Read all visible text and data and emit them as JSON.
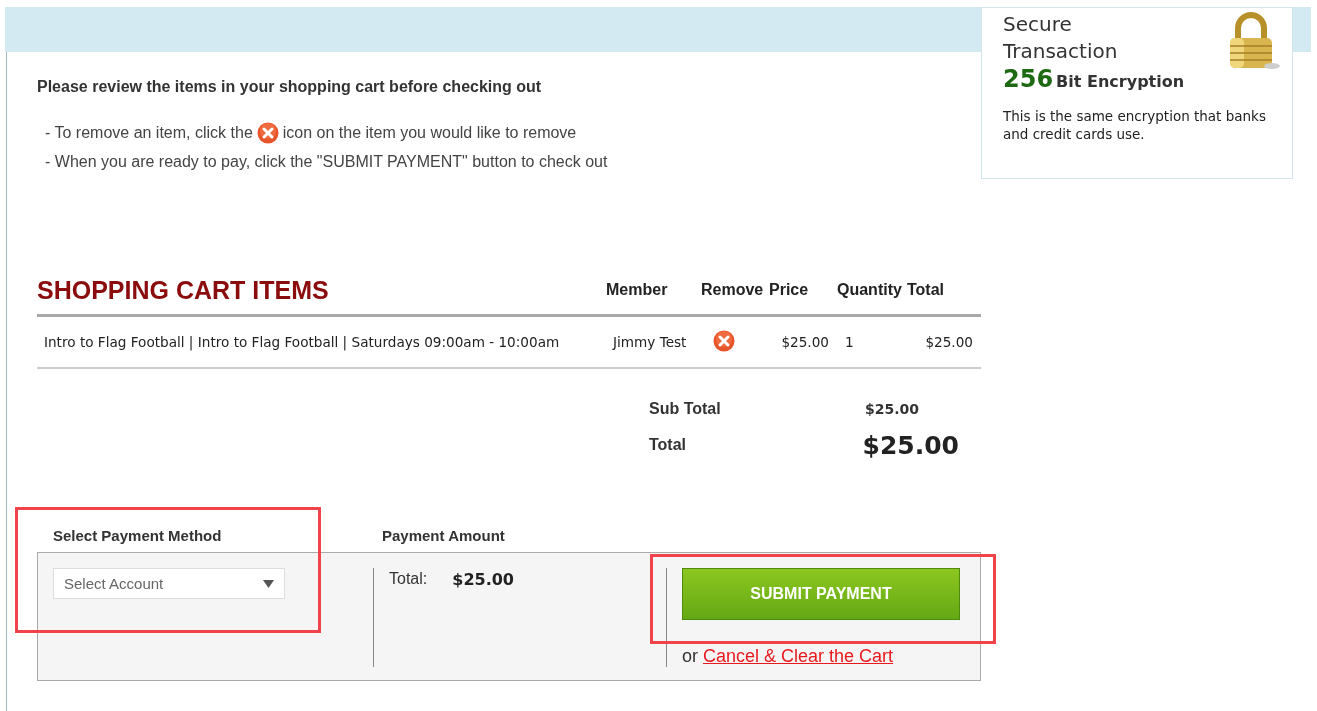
{
  "secure_box": {
    "title": "Secure Transaction",
    "bits": "256",
    "bits_label": "Bit Encryption",
    "note": "This is the same encryption that banks and credit cards use."
  },
  "intro": {
    "heading": "Please review the items in your shopping cart before checking out",
    "instructions": [
      {
        "kind": "icon",
        "before": "- To remove an item, click the",
        "after": "icon on the item you would like to remove"
      },
      {
        "kind": "text",
        "text": "- When you are ready to pay, click the \"SUBMIT PAYMENT\" button to check out"
      }
    ]
  },
  "cart": {
    "title": "SHOPPING CART ITEMS",
    "columns": [
      "Member",
      "Remove",
      "Price",
      "Quantity",
      "Total"
    ],
    "rows": [
      {
        "item": "Intro to Flag Football | Intro to Flag Football | Saturdays 09:00am - 10:00am",
        "member": "Jimmy Test",
        "price": "$25.00",
        "quantity": "1",
        "total": "$25.00"
      }
    ],
    "summary": [
      {
        "kind": "sub",
        "label": "Sub Total",
        "value": "$25.00"
      },
      {
        "kind": "grand",
        "label": "Total",
        "value": "$25.00"
      }
    ]
  },
  "payment": {
    "method_label": "Select Payment Method",
    "amount_label": "Payment Amount",
    "account_placeholder": "Select Account",
    "total_label": "Total:",
    "total_value": "$25.00",
    "submit": "SUBMIT PAYMENT",
    "or": "or",
    "cancel": "Cancel & Clear the Cart"
  }
}
